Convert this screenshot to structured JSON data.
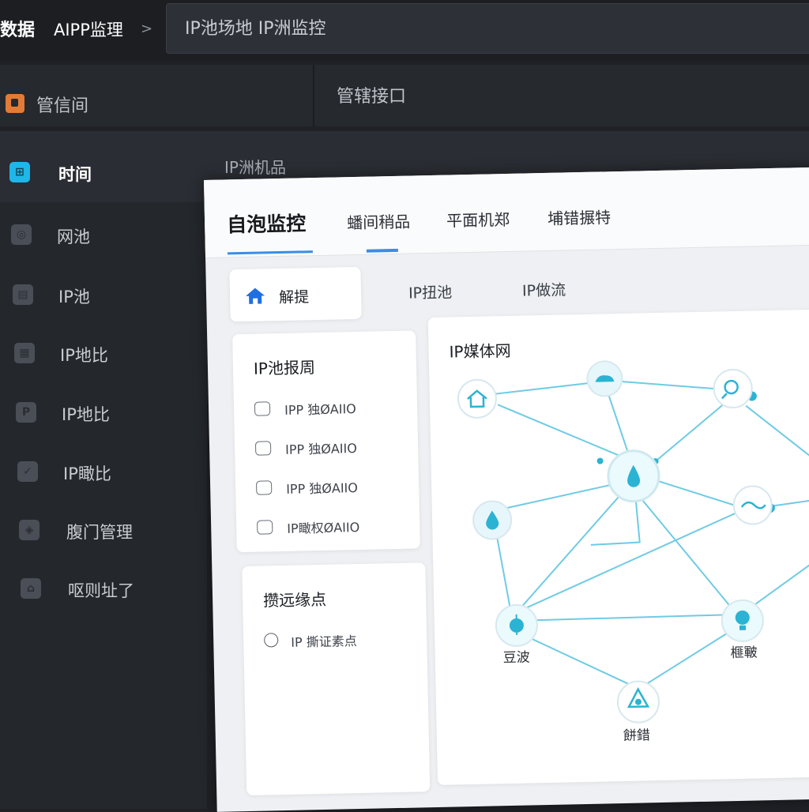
{
  "topbar": {
    "brand": "数据",
    "product": "AIPP监理",
    "breadcrumb_separator": ">",
    "search_text": "IP池场地  IP洲监控"
  },
  "header2": {
    "app_label": "管信间",
    "interface_label": "管辖接口"
  },
  "header3": {
    "product_tab": "IP洲机品"
  },
  "sidebar": {
    "items": [
      {
        "label": "时间",
        "icon": "grid-icon",
        "active": true
      },
      {
        "label": "网池",
        "icon": "target-icon",
        "active": false
      },
      {
        "label": "IP池",
        "icon": "terminal-icon",
        "active": false
      },
      {
        "label": "IP地比",
        "icon": "document-icon",
        "active": false
      },
      {
        "label": "IP地比",
        "icon": "ip-icon",
        "active": false
      },
      {
        "label": "IP瞰比",
        "icon": "check-icon",
        "active": false
      },
      {
        "label": "腹门管理",
        "icon": "shield-icon",
        "active": false
      },
      {
        "label": "呕则址了",
        "icon": "house-icon",
        "active": false
      }
    ]
  },
  "main": {
    "tabs": [
      {
        "label": "自泡监控",
        "active": true
      },
      {
        "label": "蟠间稍品",
        "active": false
      },
      {
        "label": "平面机郑",
        "active": false
      },
      {
        "label": "埔错搌特",
        "active": false
      }
    ],
    "subtabs": [
      {
        "label": "解提",
        "icon": "home-icon",
        "active": true
      },
      {
        "label": "IP扭池",
        "active": false
      },
      {
        "label": "IP做流",
        "active": false
      }
    ],
    "pool_card": {
      "title": "IP池报周",
      "rows": [
        "IPP 独ØAIIO",
        "IPP 独ØAIIO",
        "IPP 独ØAIIO",
        "IP瞰权ØAIIO"
      ]
    },
    "node_card": {
      "title": "攒远缘点",
      "radio_label": "IP 撕证素点"
    },
    "network_card": {
      "title": "IP媒体网",
      "nodes": [
        {
          "id": "home",
          "icon": "home-icon",
          "label": ""
        },
        {
          "id": "cloud",
          "icon": "cloud-icon",
          "label": ""
        },
        {
          "id": "search",
          "icon": "search-icon",
          "label": ""
        },
        {
          "id": "center",
          "icon": "drop-icon",
          "label": ""
        },
        {
          "id": "drop",
          "icon": "water-icon",
          "label": ""
        },
        {
          "id": "link",
          "icon": "link-icon",
          "label": ""
        },
        {
          "id": "beacon",
          "icon": "pin-icon",
          "label": "豆波"
        },
        {
          "id": "bulb",
          "icon": "bulb-icon",
          "label": "榧皸"
        },
        {
          "id": "shelter",
          "icon": "tent-icon",
          "label": "餅錯"
        }
      ]
    }
  },
  "colors": {
    "accent": "#3a8ee6",
    "node_line": "#6fcbe4",
    "node_fill": "#2bb3d3",
    "sidebar_active": "#1fb6e8",
    "app_icon": "#e27b35"
  }
}
